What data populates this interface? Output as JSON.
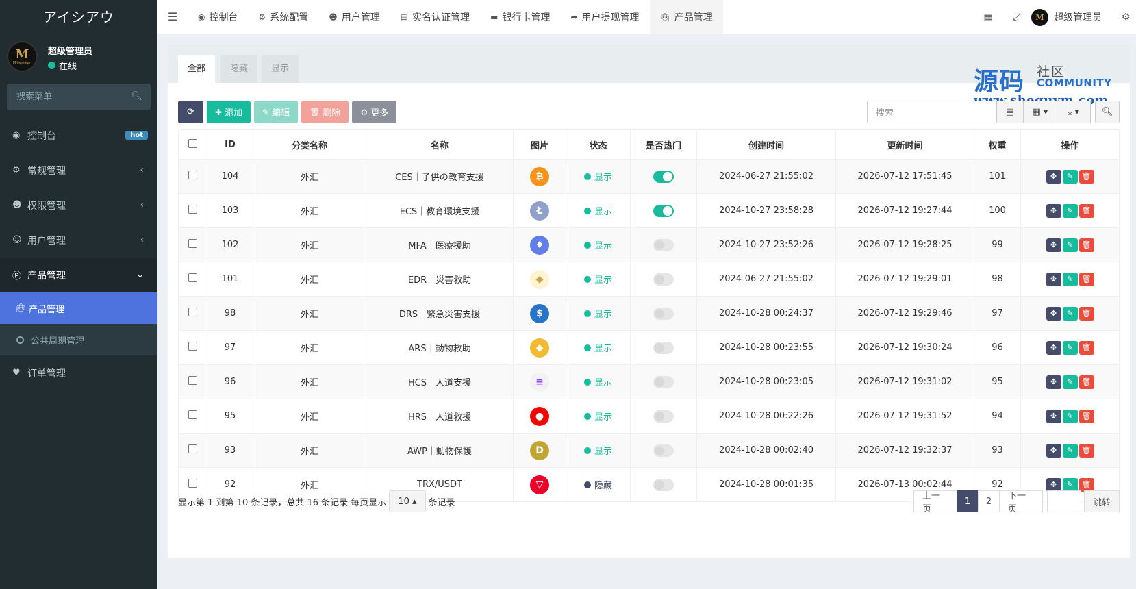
{
  "brand": "アイシアウ",
  "user": {
    "name": "超级管理员",
    "status": "在线",
    "avatar_letter": "M",
    "avatar_sub": "Millennium"
  },
  "sidebar": {
    "search_placeholder": "搜索菜单",
    "items": [
      {
        "label": "控制台",
        "icon": "dashboard-icon",
        "badge": "hot"
      },
      {
        "label": "常规管理",
        "icon": "cogs-icon"
      },
      {
        "label": "权限管理",
        "icon": "group-icon"
      },
      {
        "label": "用户管理",
        "icon": "user-circle-icon"
      },
      {
        "label": "产品管理",
        "icon": "product-icon"
      },
      {
        "label": "订单管理",
        "icon": "heartbeat-icon"
      }
    ],
    "submenu": [
      {
        "label": "产品管理",
        "icon": "shopping-bag-icon"
      },
      {
        "label": "公共周期管理",
        "icon": "circle-o-icon"
      }
    ]
  },
  "topnav": {
    "tabs": [
      {
        "label": "控制台",
        "icon": "dashboard-icon"
      },
      {
        "label": "系统配置",
        "icon": "cog-icon"
      },
      {
        "label": "用户管理",
        "icon": "user-icon"
      },
      {
        "label": "实名认证管理",
        "icon": "id-card-icon"
      },
      {
        "label": "银行卡管理",
        "icon": "credit-card-icon"
      },
      {
        "label": "用户提现管理",
        "icon": "sign-out-icon"
      },
      {
        "label": "产品管理",
        "icon": "shopping-bag-icon"
      }
    ],
    "admin": "超级管理员"
  },
  "panel": {
    "tabs": [
      "全部",
      "隐藏",
      "显示"
    ],
    "watermark": {
      "big": "源码",
      "small": "社区",
      "en": "COMMUNITY",
      "url": "www.shequym.com"
    }
  },
  "toolbar": {
    "add": "添加",
    "edit": "编辑",
    "delete": "删除",
    "more": "更多",
    "search_placeholder": "搜索"
  },
  "table": {
    "headers": [
      "ID",
      "分类名称",
      "名称",
      "图片",
      "状态",
      "是否热门",
      "创建时间",
      "更新时间",
      "权重",
      "操作"
    ],
    "rows": [
      {
        "id": "104",
        "category": "外汇",
        "name": "CES｜子供の教育支援",
        "coin": "bitcoin",
        "status": "显示",
        "hot": true,
        "created": "2024-06-27 21:55:02",
        "updated": "2026-07-12 17:51:45",
        "weight": "101"
      },
      {
        "id": "103",
        "category": "外汇",
        "name": "ECS｜教育環境支援",
        "coin": "litecoin",
        "status": "显示",
        "hot": true,
        "created": "2024-10-27 23:58:28",
        "updated": "2026-07-12 19:27:44",
        "weight": "100"
      },
      {
        "id": "102",
        "category": "外汇",
        "name": "MFA｜医療援助",
        "coin": "ethereum",
        "status": "显示",
        "hot": false,
        "created": "2024-10-27 23:52:26",
        "updated": "2026-07-12 19:28:25",
        "weight": "99"
      },
      {
        "id": "101",
        "category": "外汇",
        "name": "EDR｜災害救助",
        "coin": "tether-gold",
        "status": "显示",
        "hot": false,
        "created": "2024-06-27 21:55:02",
        "updated": "2026-07-12 19:29:01",
        "weight": "98"
      },
      {
        "id": "98",
        "category": "外汇",
        "name": "DRS｜緊急災害支援",
        "coin": "usd-coin",
        "status": "显示",
        "hot": false,
        "created": "2024-10-28 00:24:37",
        "updated": "2026-07-12 19:29:46",
        "weight": "97"
      },
      {
        "id": "97",
        "category": "外汇",
        "name": "ARS｜動物救助",
        "coin": "binance",
        "status": "显示",
        "hot": false,
        "created": "2024-10-28 00:23:55",
        "updated": "2026-07-12 19:30:24",
        "weight": "96"
      },
      {
        "id": "96",
        "category": "外汇",
        "name": "HCS｜人道支援",
        "coin": "solana",
        "status": "显示",
        "hot": false,
        "created": "2024-10-28 00:23:05",
        "updated": "2026-07-12 19:31:02",
        "weight": "95"
      },
      {
        "id": "95",
        "category": "外汇",
        "name": "HRS｜人道救援",
        "coin": "shiba",
        "status": "显示",
        "hot": false,
        "created": "2024-10-28 00:22:26",
        "updated": "2026-07-12 19:31:52",
        "weight": "94"
      },
      {
        "id": "93",
        "category": "外汇",
        "name": "AWP｜動物保護",
        "coin": "dogecoin",
        "status": "显示",
        "hot": false,
        "created": "2024-10-28 00:02:40",
        "updated": "2026-07-12 19:32:37",
        "weight": "93"
      },
      {
        "id": "92",
        "category": "外汇",
        "name": "TRX/USDT",
        "coin": "tron",
        "status": "隐藏",
        "hot": false,
        "created": "2024-10-28 00:01:35",
        "updated": "2026-07-13 00:02:44",
        "weight": "92"
      }
    ]
  },
  "pagination": {
    "info_prefix": "显示第 1 到第 10 条记录，总共 16 条记录 每页显示",
    "page_size": "10",
    "info_suffix": "条记录",
    "prev": "上一页",
    "pages": [
      "1",
      "2"
    ],
    "next": "下一页",
    "go": "跳转"
  },
  "colors": {
    "accent": "#4e73df",
    "green": "#18bc9c",
    "sidebar": "#222d32",
    "hidden_dot": "#444c69"
  }
}
